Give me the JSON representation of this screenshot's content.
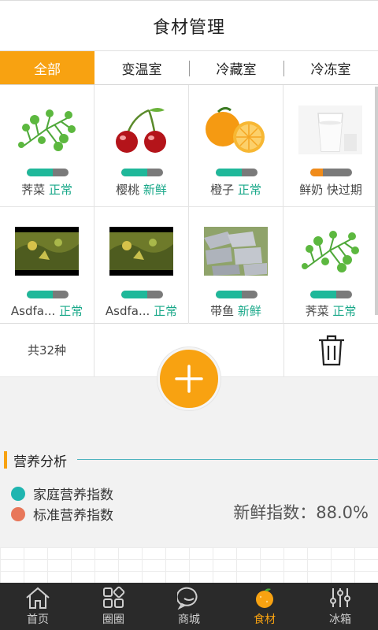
{
  "header": {
    "title": "食材管理"
  },
  "tabs": [
    {
      "label": "全部",
      "active": true
    },
    {
      "label": "变温室",
      "active": false
    },
    {
      "label": "冷藏室",
      "active": false
    },
    {
      "label": "冷冻室",
      "active": false
    }
  ],
  "items": [
    {
      "name": "荠菜",
      "status": "正常",
      "freshness": 0.62,
      "bar_color": "#1fb89a",
      "image": "herb-icon"
    },
    {
      "name": "樱桃",
      "status": "新鲜",
      "freshness": 0.62,
      "bar_color": "#1fb89a",
      "image": "cherry-icon"
    },
    {
      "name": "橙子",
      "status": "正常",
      "freshness": 0.62,
      "bar_color": "#1fb89a",
      "image": "orange-icon"
    },
    {
      "name": "鲜奶",
      "status": "快过期",
      "freshness": 0.3,
      "bar_color": "#f08b1a",
      "image": "milk-icon"
    },
    {
      "name": "Asdfa...",
      "status": "正常",
      "freshness": 0.62,
      "bar_color": "#1fb89a",
      "image": "video-thumbnail"
    },
    {
      "name": "Asdfa...",
      "status": "正常",
      "freshness": 0.62,
      "bar_color": "#1fb89a",
      "image": "video-thumbnail"
    },
    {
      "name": "带鱼",
      "status": "新鲜",
      "freshness": 0.62,
      "bar_color": "#1fb89a",
      "image": "fish-icon"
    },
    {
      "name": "荠菜",
      "status": "正常",
      "freshness": 0.62,
      "bar_color": "#1fb89a",
      "image": "herb-icon"
    }
  ],
  "summary": {
    "count_text": "共32种",
    "delete_icon": "trash-icon",
    "add_icon": "plus-icon"
  },
  "nutrition": {
    "title": "营养分析",
    "legend": [
      {
        "label": "家庭营养指数",
        "color": "#1fb5b0"
      },
      {
        "label": "标准营养指数",
        "color": "#e8775a"
      }
    ],
    "freshness_label": "新鲜指数：88.0%"
  },
  "nav": [
    {
      "label": "首页",
      "icon": "home-icon",
      "active": false
    },
    {
      "label": "圈圈",
      "icon": "apps-icon",
      "active": false
    },
    {
      "label": "商城",
      "icon": "chat-bubble-icon",
      "active": false
    },
    {
      "label": "食材",
      "icon": "orange-fruit-icon",
      "active": true
    },
    {
      "label": "冰箱",
      "icon": "sliders-icon",
      "active": false
    }
  ],
  "colors": {
    "accent": "#f8a211",
    "fresh_green": "#19a889",
    "nav_bg": "#2a2a2a"
  }
}
